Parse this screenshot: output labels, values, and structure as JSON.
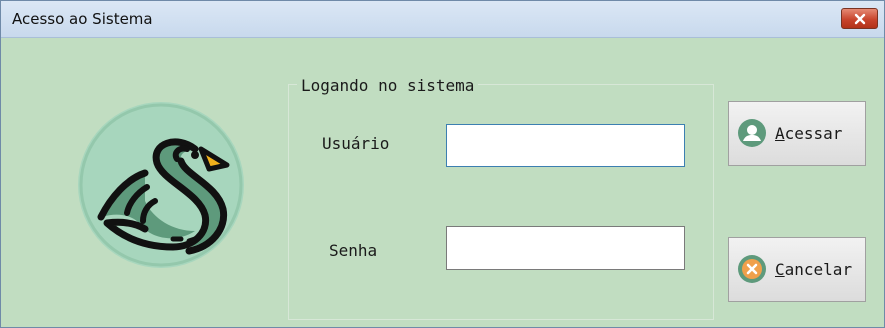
{
  "window": {
    "title": "Acesso ao Sistema"
  },
  "icons": {
    "close": "close-icon",
    "logo": "swan-logo",
    "user": "user-icon",
    "cancel": "cancel-icon"
  },
  "login_group": {
    "legend": "Logando no sistema",
    "username": {
      "label": "Usuário",
      "value": ""
    },
    "password": {
      "label": "Senha",
      "value": ""
    }
  },
  "buttons": {
    "access": {
      "mnemonic": "A",
      "rest": "cessar"
    },
    "cancel": {
      "mnemonic": "C",
      "rest": "ancelar"
    }
  },
  "colors": {
    "background": "#c1ddc1",
    "logo_circle": "#a7d6bd",
    "logo_swan": "#5e9a7c",
    "beak": "#f2b21c",
    "close_button": "#c8452d",
    "user_icon": "#5e9a7c",
    "cancel_icon": "#f0a04b"
  }
}
